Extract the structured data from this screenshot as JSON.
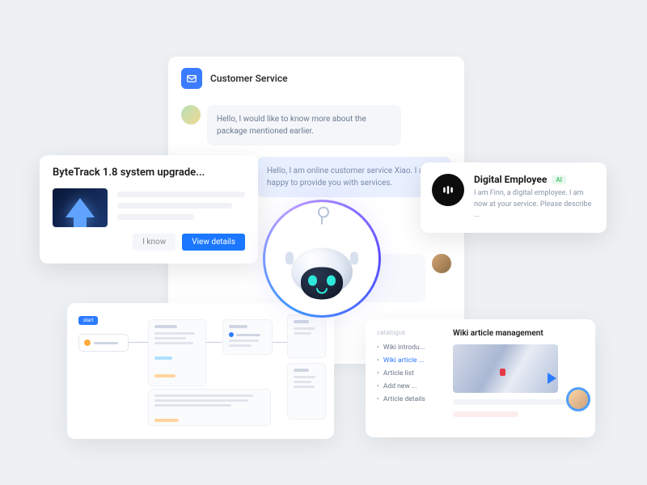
{
  "chat": {
    "title": "Customer Service",
    "messages": [
      {
        "text": "Hello, I would like to know more about the package mentioned earlier."
      },
      {
        "text": "Hello, I am online customer service Xiao. I am happy to provide you with services."
      }
    ]
  },
  "upgrade": {
    "title": "ByteTrack 1.8 system upgrade...",
    "actions": {
      "dismiss": "I know",
      "details": "View details"
    }
  },
  "digital": {
    "title": "Digital Employee",
    "badge": "AI",
    "description": "I am Finn, a digital employee. I am now at your service. Please describe ..."
  },
  "wiki": {
    "category_label": "catalogue",
    "title": "Wiki article management",
    "items": [
      {
        "label": "Wiki introdu...",
        "active": false
      },
      {
        "label": "Wiki article ...",
        "active": true
      },
      {
        "label": "Article list",
        "active": false
      },
      {
        "label": "Add new ...",
        "active": false
      },
      {
        "label": "Article details",
        "active": false
      }
    ]
  }
}
